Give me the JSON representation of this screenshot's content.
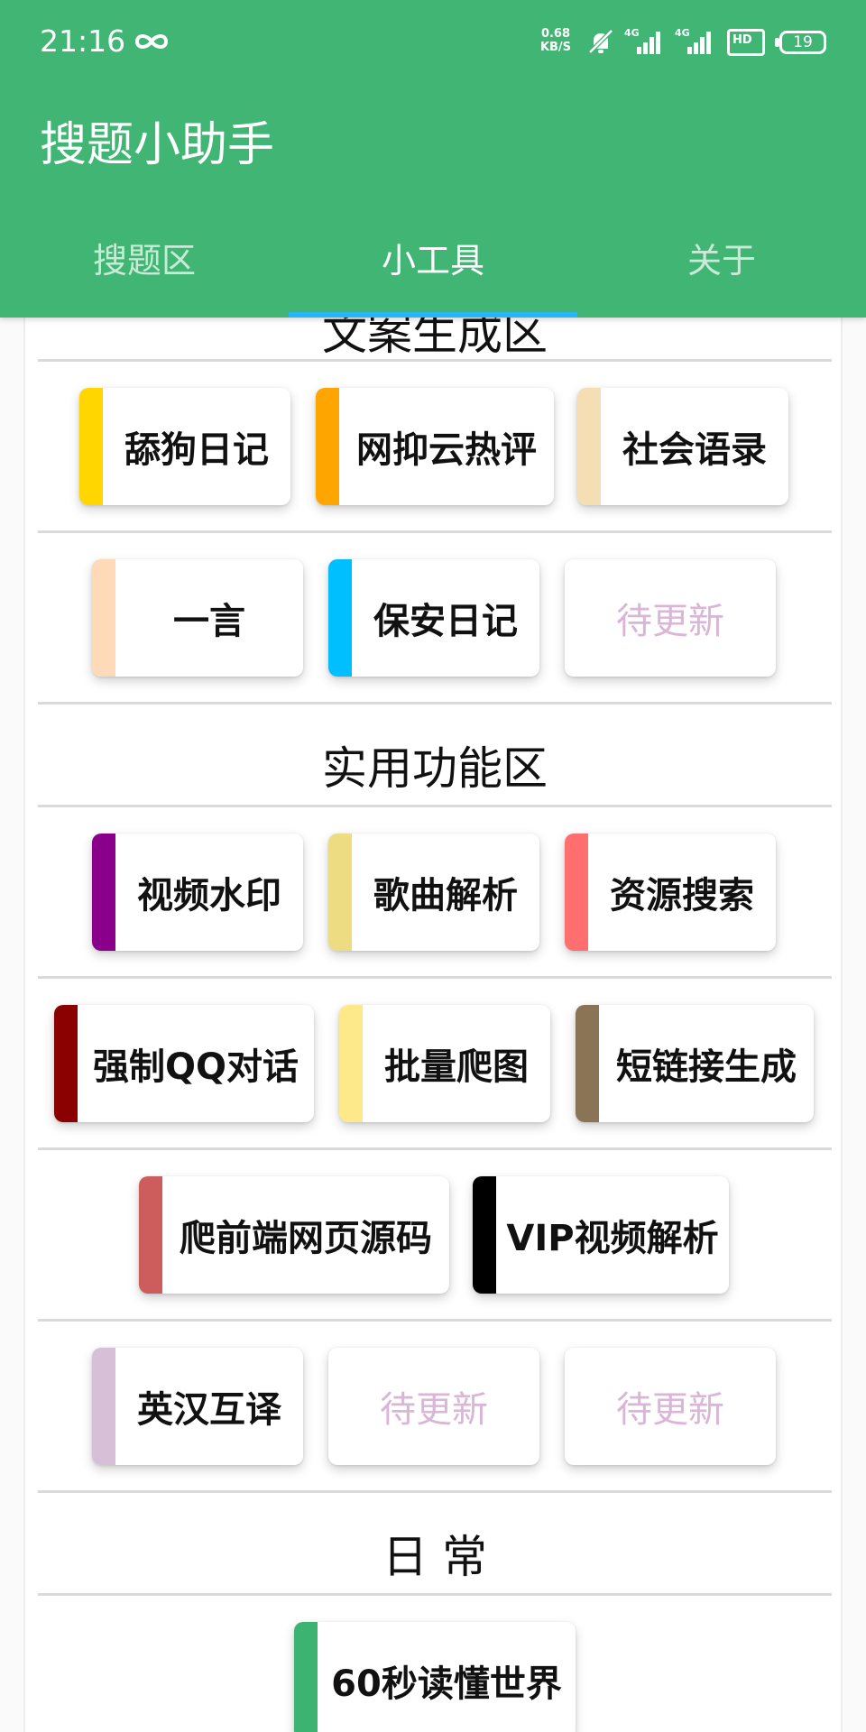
{
  "status_bar": {
    "time": "21:16",
    "net_speed_value": "0.68",
    "net_speed_unit": "KB/S",
    "signal1_label": "4G",
    "signal2_label": "4G",
    "hd_label": "HD",
    "battery": "19"
  },
  "app": {
    "title": "搜题小助手"
  },
  "tabs": [
    {
      "label": "搜题区",
      "active": false
    },
    {
      "label": "小工具",
      "active": true
    },
    {
      "label": "关于",
      "active": false
    }
  ],
  "sections": {
    "copywriting": {
      "title": "文案生成区",
      "row1": [
        {
          "label": "舔狗日记",
          "color": "#ffd600"
        },
        {
          "label": "网抑云热评",
          "color": "#ffa500"
        },
        {
          "label": "社会语录",
          "color": "#f5deb3"
        }
      ],
      "row2": [
        {
          "label": "一言",
          "color": "#ffdab9"
        },
        {
          "label": "保安日记",
          "color": "#00bfff"
        },
        {
          "label": "待更新"
        }
      ]
    },
    "utility": {
      "title": "实用功能区",
      "row1": [
        {
          "label": "视频水印",
          "color": "#8b008b"
        },
        {
          "label": "歌曲解析",
          "color": "#eedc82"
        },
        {
          "label": "资源搜索",
          "color": "#ff6f6f"
        }
      ],
      "row2": [
        {
          "label": "强制QQ对话",
          "color": "#8b0000"
        },
        {
          "label": "批量爬图",
          "color": "#fde98a"
        },
        {
          "label": "短链接生成",
          "color": "#8b7355"
        }
      ],
      "row3": [
        {
          "label": "爬前端网页源码",
          "color": "#cd5c5c"
        },
        {
          "label": "VIP视频解析",
          "color": "#000000"
        }
      ],
      "row4": [
        {
          "label": "英汉互译",
          "color": "#d8bfd8"
        },
        {
          "label": "待更新"
        },
        {
          "label": "待更新"
        }
      ]
    },
    "daily": {
      "title": "日 常",
      "row1": [
        {
          "label": "60秒读懂世界",
          "color": "#3cb371"
        }
      ]
    }
  }
}
